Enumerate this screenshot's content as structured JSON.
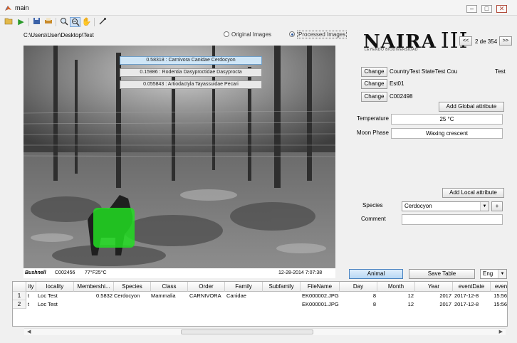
{
  "window": {
    "title": "main",
    "min": "–",
    "max": "□",
    "close": "✕"
  },
  "toolbar": {
    "icons": [
      "folder-open-icon",
      "play-icon",
      "save-icon",
      "print-icon",
      "zoom-in-icon",
      "zoom-out-icon",
      "pan-icon",
      "data-cursor-icon"
    ]
  },
  "path": "C:\\Users\\User\\Desktop\\Test",
  "view_options": {
    "original": "Original Images",
    "processed": "Processed Images"
  },
  "predictions": [
    "0.58318 : Carnivora Canidae Cerdocyon",
    "0.15986 : Rodentia Dasyproctidae Dasyprocta",
    "0.055843 : Artiodactyla Tayassuidae Pecari"
  ],
  "photo_footer": {
    "brand": "Bushnell",
    "id": "C002456",
    "temp": "77°F25°C",
    "datetime": "12-28-2014  7:07:38"
  },
  "logo": {
    "name": "NAIRA",
    "numeral": "III",
    "tagline": "LEYENDO BIODIVERSIDAD"
  },
  "nav": {
    "prev": "<<",
    "next": ">>",
    "counter": "2 de 354"
  },
  "global_attrs": {
    "change_label": "Change",
    "location": "CountryTest StateTest Cou",
    "location_right": "Test",
    "station": "Est01",
    "camera": "C002498",
    "add_global": "Add Global attribute",
    "temperature_label": "Temperature",
    "temperature_value": "25 °C",
    "moon_label": "Moon Phase",
    "moon_value": "Waxing crescent"
  },
  "local_attrs": {
    "add_local": "Add Local attribute",
    "species_label": "Species",
    "species_value": "Cerdocyon",
    "plus": "+",
    "comment_label": "Comment"
  },
  "actions": {
    "animal": "Animal",
    "save_table": "Save Table",
    "lang": "Eng"
  },
  "table": {
    "columns": [
      "ity",
      "locality",
      "Membershi...",
      "Species",
      "Class",
      "Order",
      "Family",
      "Subfamily",
      "FileName",
      "Day",
      "Month",
      "Year",
      "eventDate",
      "even"
    ],
    "rows": [
      {
        "n": "1",
        "cells": [
          "t",
          "Loc Test",
          "0.5832",
          "Cerdocyon",
          "Mammalia",
          "CARNIVORA",
          "Canidae",
          "",
          "EK000002.JPG",
          "8",
          "12",
          "2017",
          "2017-12-8",
          "15:56"
        ]
      },
      {
        "n": "2",
        "cells": [
          "t",
          "Loc Test",
          "",
          "",
          "",
          "",
          "",
          "",
          "EK000001.JPG",
          "8",
          "12",
          "2017",
          "2017-12-8",
          "15:56"
        ]
      }
    ]
  },
  "colors": {
    "selection_green": "#22dd22",
    "accent_blue": "#4a83c0"
  }
}
